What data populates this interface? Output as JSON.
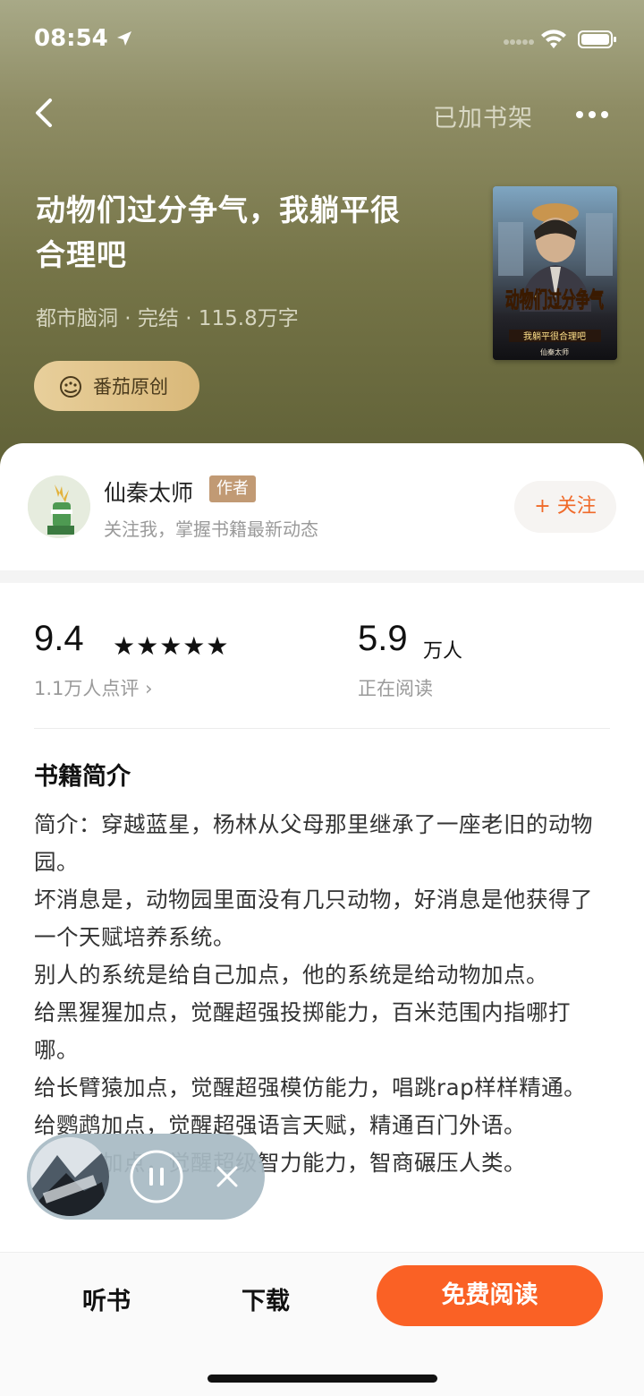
{
  "status_bar": {
    "time": "08:54"
  },
  "header": {
    "shelf_status": "已加书架"
  },
  "book": {
    "title": "动物们过分争气，我躺平很合理吧",
    "meta": "都市脑洞 · 完结 · 115.8万字",
    "badge": "番茄原创",
    "cover": {
      "title_text": "动物们过分争气",
      "subtitle_text": "我躺平很合理吧",
      "author_text": "仙秦太师"
    }
  },
  "author": {
    "name": "仙秦太师",
    "tag": "作者",
    "description": "关注我，掌握书籍最新动态",
    "follow_label": "+ 关注"
  },
  "stats": {
    "rating": "9.4",
    "stars": "★★★★★",
    "review_count": "1.1万人点评 ›",
    "readers": "5.9",
    "readers_unit": "万人",
    "readers_label": "正在阅读"
  },
  "intro": {
    "heading": "书籍简介",
    "paragraphs": [
      "简介：穿越蓝星，杨林从父母那里继承了一座老旧的动物园。",
      "坏消息是，动物园里面没有几只动物，好消息是他获得了一个天赋培养系统。",
      "别人的系统是给自己加点，他的系统是给动物加点。",
      "给黑猩猩加点，觉醒超强投掷能力，百米范围内指哪打哪。",
      "给长臂猿加点，觉醒超强模仿能力，唱跳rap样样精通。",
      "给鹦鹉加点，觉醒超强语言天赋，精通百门外语。",
      "给边牧加点，觉醒超级智力能力，智商碾压人类。"
    ]
  },
  "bottom_bar": {
    "listen_label": "听书",
    "download_label": "下载",
    "read_label": "免费阅读"
  },
  "colors": {
    "accent": "#fa6125",
    "badge_gold": "#e8cf9b",
    "author_tag": "#c19a74",
    "hero_top": "#a8a987",
    "hero_bottom": "#5f6036"
  }
}
